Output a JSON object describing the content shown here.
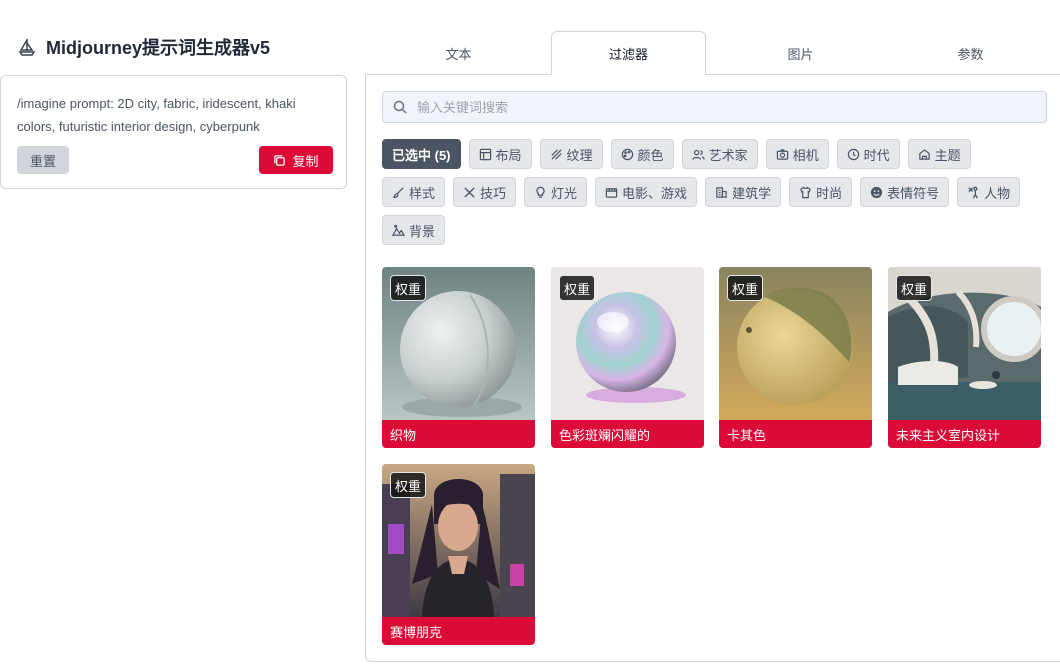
{
  "app": {
    "title": "Midjourney提示词生成器v5"
  },
  "prompt": {
    "text": "/imagine prompt: 2D city, fabric, iridescent, khaki colors, futuristic interior design, cyberpunk",
    "reset_label": "重置",
    "copy_label": "复制"
  },
  "tabs": [
    "文本",
    "过滤器",
    "图片",
    "参数"
  ],
  "active_tab": "过滤器",
  "search": {
    "placeholder": "输入关键词搜索"
  },
  "filters": {
    "selected_label": "已选中 (5)",
    "chips": [
      "布局",
      "纹理",
      "颜色",
      "艺术家",
      "相机",
      "时代",
      "主题",
      "样式",
      "技巧",
      "灯光",
      "电影、游戏",
      "建筑学",
      "时尚",
      "表情符号",
      "人物",
      "背景"
    ]
  },
  "cards": [
    {
      "badge": "权重",
      "label": "织物"
    },
    {
      "badge": "权重",
      "label": "色彩斑斓闪耀的"
    },
    {
      "badge": "权重",
      "label": "卡其色"
    },
    {
      "badge": "权重",
      "label": "未来主义室内设计"
    },
    {
      "badge": "权重",
      "label": "赛博朋克"
    }
  ],
  "colors": {
    "accent": "#dc0a36",
    "chip_active": "#4b5563",
    "chip": "#e5e7eb"
  }
}
